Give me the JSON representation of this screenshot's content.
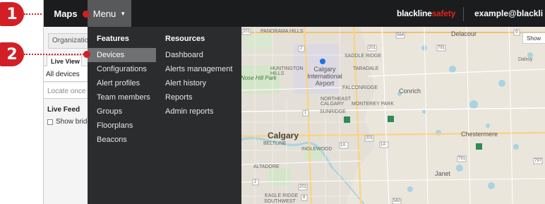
{
  "navbar": {
    "maps_label": "Maps",
    "menu_label": "Menu",
    "brand_main": "blackline",
    "brand_accent": "safety",
    "user_email": "example@blackli"
  },
  "left_panel": {
    "organization_placeholder": "Organization",
    "tab_label": "Live View",
    "all_devices": "All devices",
    "locate_placeholder": "Locate once",
    "live_feed_heading": "Live Feed",
    "show_bridges_label": "Show bridge"
  },
  "menu": {
    "features_heading": "Features",
    "features_items": [
      "Devices",
      "Configurations",
      "Alert profiles",
      "Team members",
      "Groups",
      "Floorplans",
      "Beacons"
    ],
    "active_item": "Devices",
    "resources_heading": "Resources",
    "resources_items": [
      "Dashboard",
      "Alerts management",
      "Alert history",
      "Reports",
      "Admin reports"
    ]
  },
  "map": {
    "show_button": "Show",
    "labels": {
      "panorama_hills": "PANORAMA HILLS",
      "saddle_ridge": "SADDLE RIDGE",
      "huntington_hills": "HUNTINGTON HILLS",
      "airport": "Calgary International Airport",
      "taradale": "TARADALE",
      "nose_hill_park": "Nose Hill Park",
      "falconridge": "FALCONRIDGE",
      "conrich": "Conrich",
      "northeast_calgary": "NORTHEAST CALGARY",
      "monterey_park": "MONTEREY PARK",
      "sunridge": "SUNRIDGE",
      "calgary": "Calgary",
      "beltline": "BELTLINE",
      "inglewood": "INGLEWOOD",
      "chestermere": "Chestermere",
      "altadore": "ALTADORE",
      "janet": "Janet",
      "eagle_ridge": "EAGLE RIDGE",
      "southwest": "SOUTHWEST",
      "delacour": "Delacour",
      "dalroy": "Dalroy"
    },
    "highway_shields": [
      "201",
      "2",
      "201",
      "564",
      "791",
      "9",
      "1",
      "1A",
      "201",
      "1A",
      "791",
      "797",
      "560",
      "2",
      "201",
      "8"
    ]
  },
  "callouts": [
    "1",
    "2"
  ],
  "colors": {
    "navbar_bg": "#1b1c1e",
    "menu_bg": "#2b2c2e",
    "active_item_bg": "#6f7173",
    "brand_accent": "#e2231a",
    "callout": "#d21f26"
  }
}
